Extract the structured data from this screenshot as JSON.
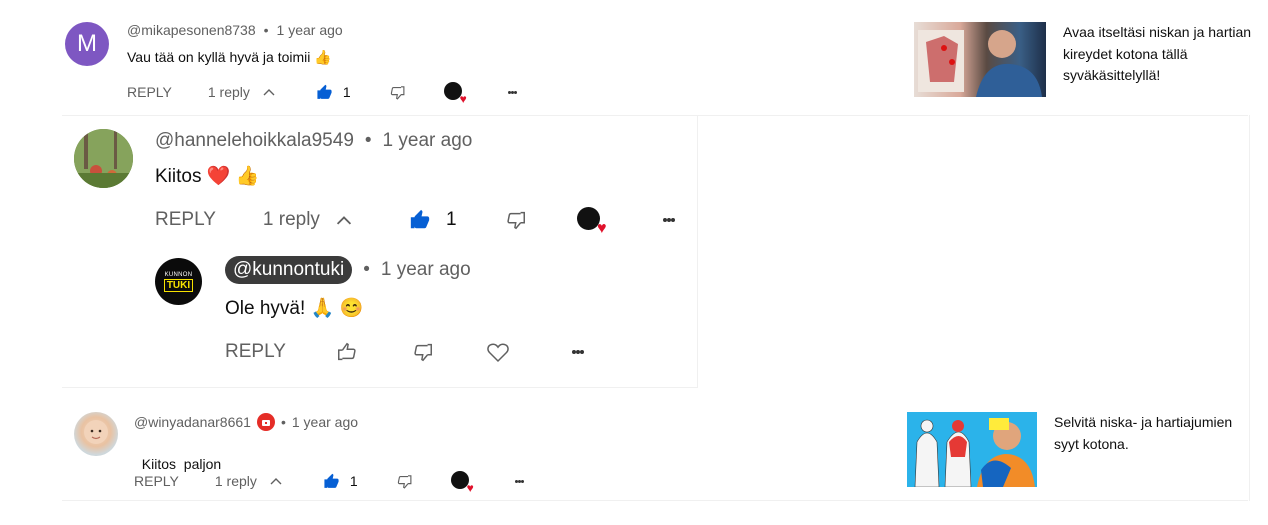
{
  "comments": [
    {
      "handle": "@mikapesonen8738",
      "avatar_letter": "M",
      "avatar_color": "#7e57c2",
      "time": "1 year ago",
      "text": "Vau tää on kyllä hyvä ja toimii",
      "emoji": "👍",
      "reply_label": "REPLY",
      "replies_label": "1 reply",
      "likes": "1"
    },
    {
      "handle": "@hannelehoikkala9549",
      "time": "1 year ago",
      "text": "Kiitos",
      "emoji": "❤️ 👍",
      "reply_label": "REPLY",
      "replies_label": "1 reply",
      "likes": "1"
    },
    {
      "handle": "@kunnontuki",
      "avatar_text_top": "KUNNON",
      "avatar_text_bottom": "TUKI",
      "time": "1 year ago",
      "text": "Ole hyvä!",
      "emoji": "🙏 😊",
      "reply_label": "REPLY"
    },
    {
      "handle": "@winyadanar8661",
      "time": "1 year ago",
      "text": "Kiitos  paljon",
      "reply_label": "REPLY",
      "replies_label": "1 reply",
      "likes": "1"
    }
  ],
  "sidebar_cards": [
    {
      "text": "Avaa itseltäsi niskan ja hartian kireydet kotona tällä syväkäsittelyllä!"
    },
    {
      "text": "Selvitä niska- ja hartiajumien syyt kotona."
    }
  ],
  "colors": {
    "like_blue": "#065fd4",
    "heart_red": "#e0112b",
    "muted": "#606060"
  }
}
